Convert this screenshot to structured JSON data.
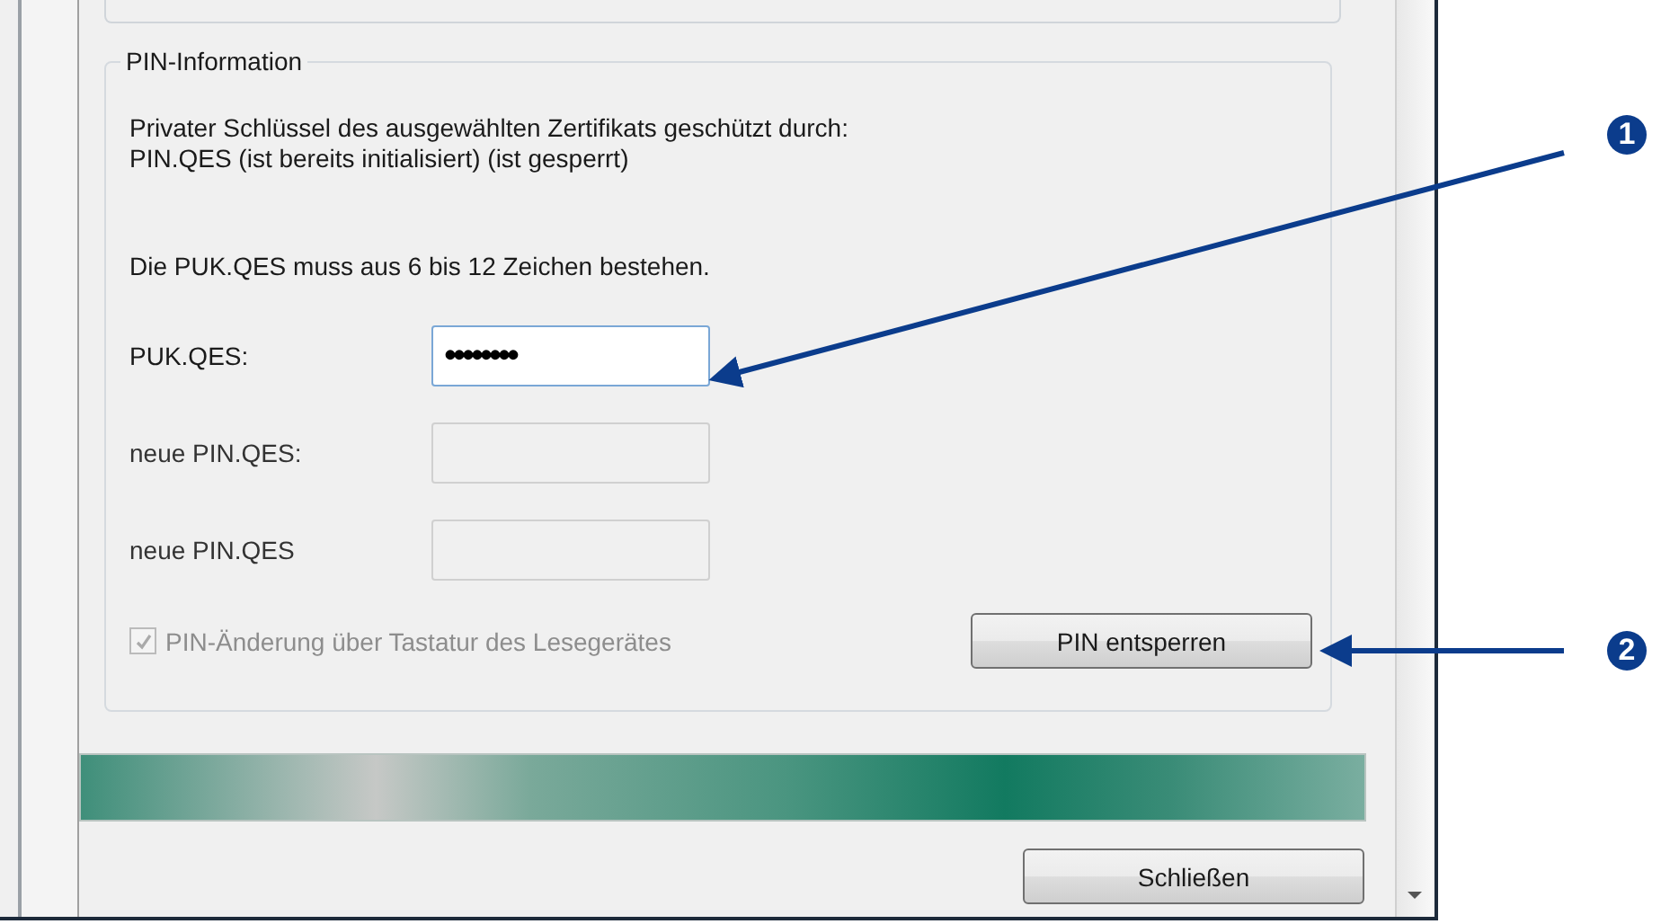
{
  "group": {
    "title": "PIN-Information",
    "info_lines": [
      "Privater Schlüssel des ausgewählten Zertifikats geschützt durch:",
      "PIN.QES  (ist bereits initialisiert) (ist gesperrt)"
    ],
    "hint": "Die PUK.QES muss aus 6 bis 12 Zeichen bestehen.",
    "fields": [
      {
        "label": "PUK.QES:",
        "value": "••••••••",
        "disabled": false,
        "focused": true
      },
      {
        "label": "neue PIN.QES:",
        "disabled": true,
        "focused": false
      },
      {
        "label": "neue PIN.QES",
        "disabled": true,
        "focused": false
      }
    ],
    "checkbox": {
      "label": "PIN-Änderung über Tastatur des Lesegerätes",
      "checked": true,
      "disabled": true
    },
    "button": "PIN entsperren"
  },
  "progress": {
    "level": 1
  },
  "close_button": "Schließen",
  "callouts": [
    {
      "number": "1"
    },
    {
      "number": "2"
    }
  ]
}
